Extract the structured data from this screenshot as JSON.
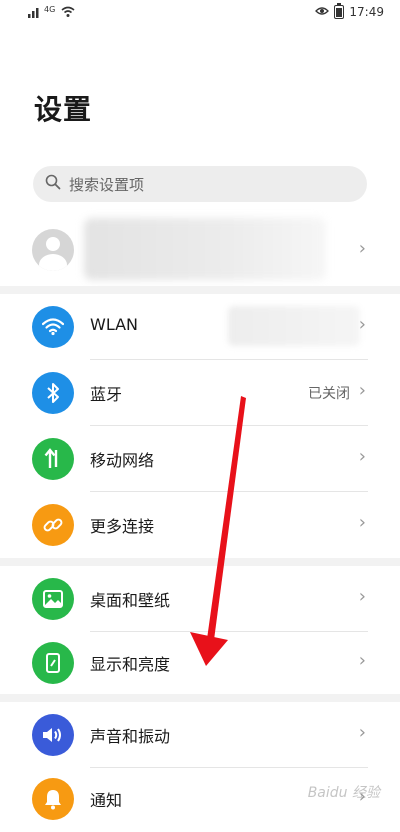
{
  "status_bar": {
    "signal_text": "4G",
    "time": "17:49"
  },
  "page": {
    "title": "设置"
  },
  "search": {
    "placeholder": "搜索设置项"
  },
  "groups": [
    [
      {
        "name": "wlan",
        "label": "WLAN",
        "value": "",
        "icon": "wifi-icon",
        "color": "#1e8fe6"
      },
      {
        "name": "bluetooth",
        "label": "蓝牙",
        "value": "已关闭",
        "icon": "bluetooth-icon",
        "color": "#1e8fe6"
      },
      {
        "name": "mobile-network",
        "label": "移动网络",
        "value": "",
        "icon": "data-transfer-icon",
        "color": "#28b84a"
      },
      {
        "name": "more-connections",
        "label": "更多连接",
        "value": "",
        "icon": "link-icon",
        "color": "#f79a12"
      }
    ],
    [
      {
        "name": "home-wallpaper",
        "label": "桌面和壁纸",
        "value": "",
        "icon": "picture-icon",
        "color": "#28b84a"
      },
      {
        "name": "display-brightness",
        "label": "显示和亮度",
        "value": "",
        "icon": "phone-display-icon",
        "color": "#28b84a"
      }
    ],
    [
      {
        "name": "sound-vibration",
        "label": "声音和振动",
        "value": "",
        "icon": "speaker-icon",
        "color": "#3a5bd9"
      },
      {
        "name": "notifications",
        "label": "通知",
        "value": "",
        "icon": "bell-icon",
        "color": "#f79a12"
      }
    ]
  ],
  "colors": {
    "annotation_arrow": "#e8111a"
  }
}
